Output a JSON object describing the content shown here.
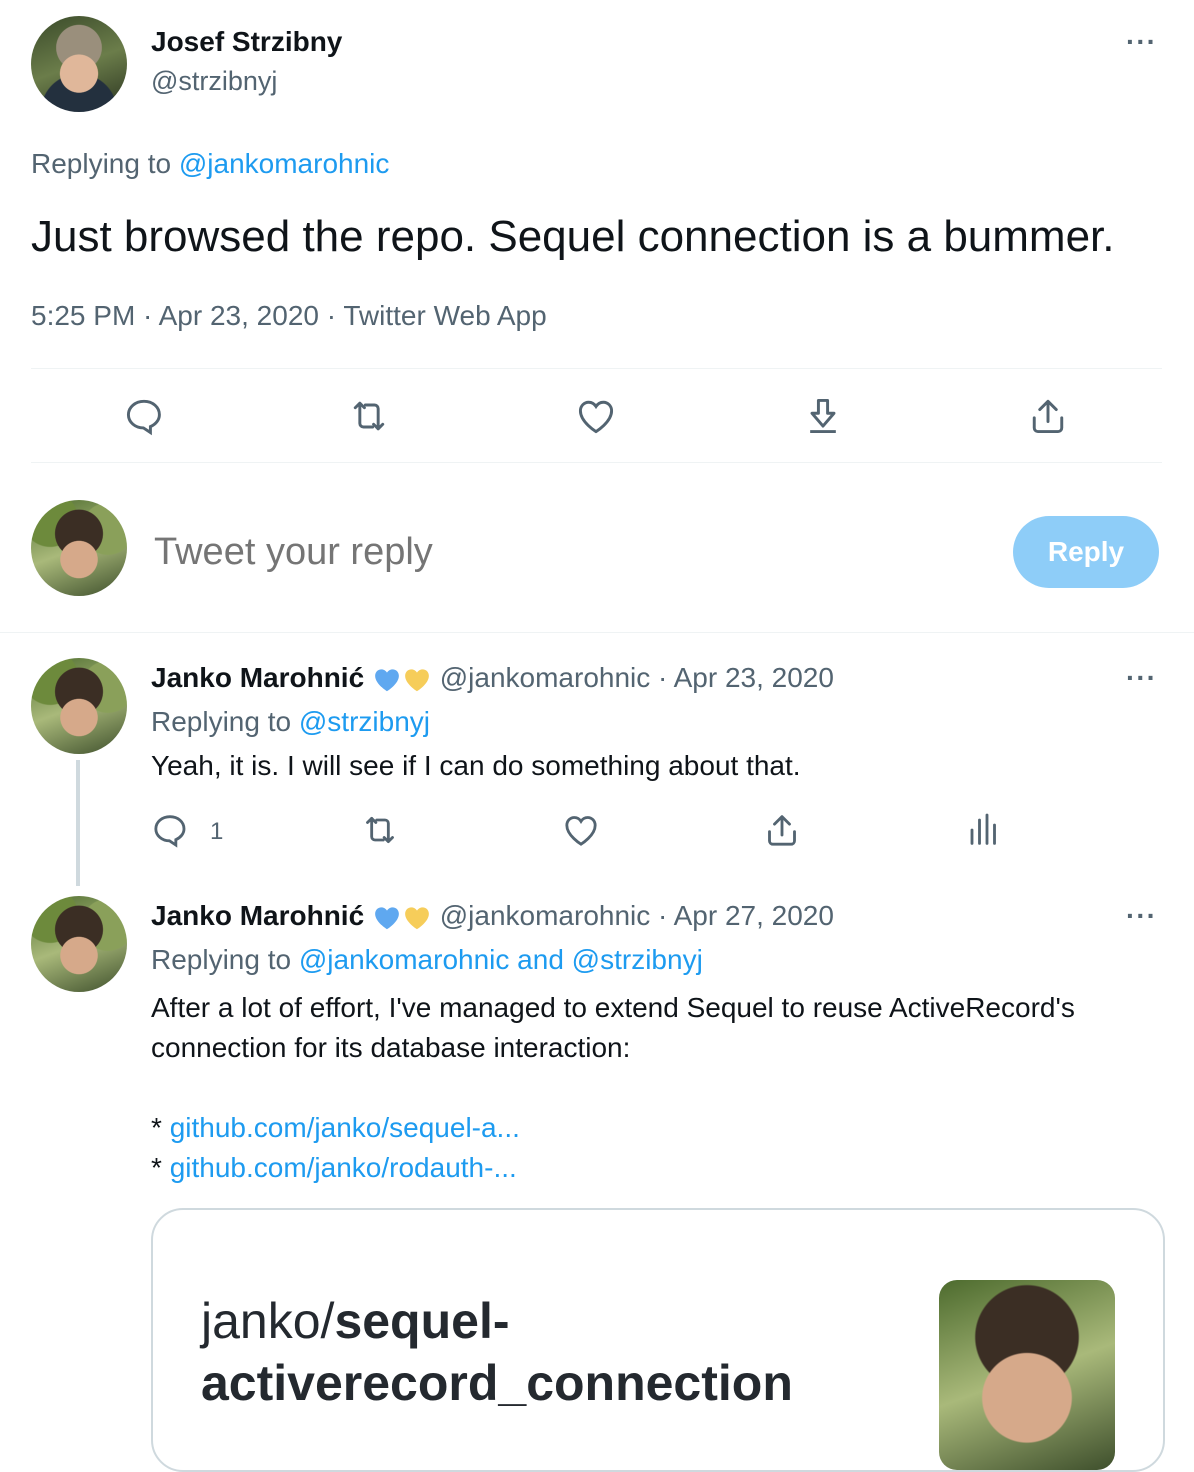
{
  "main_tweet": {
    "author_name": "Josef Strzibny",
    "author_handle": "@strzibnyj",
    "replying_prefix": "Replying to",
    "replying_to": "@jankomarohnic",
    "text": "Just browsed the repo. Sequel connection is a bummer.",
    "meta": "5:25 PM · Apr 23, 2020 · Twitter Web App",
    "more": "···"
  },
  "compose": {
    "placeholder": "Tweet your reply",
    "reply_label": "Reply"
  },
  "replies": [
    {
      "author_name": "Janko Marohnić",
      "handle_date": "@jankomarohnic · Apr 23, 2020",
      "replying_prefix": "Replying to",
      "replying_to": "@strzibnyj",
      "text": "Yeah, it is. I will see if I can do something about that.",
      "reply_count": "1",
      "more": "···"
    },
    {
      "author_name": "Janko Marohnić",
      "handle_date": "@jankomarohnic · Apr 27, 2020",
      "replying_prefix": "Replying to",
      "replying_to": "@jankomarohnic and @strzibnyj",
      "text_line1": "After a lot of effort, I've managed to extend Sequel to reuse ActiveRecord's",
      "text_line2": "connection for its database interaction:",
      "bullet": "*",
      "link1": "github.com/janko/sequel-a...",
      "link2": "github.com/janko/rodauth-...",
      "more": "···",
      "card": {
        "title_prefix": "janko/",
        "title_bold1": "sequel-",
        "title_bold2": "activerecord_connection"
      }
    }
  ],
  "colors": {
    "link": "#1d9bf0",
    "heart_blue": "#5fa8f0",
    "heart_yellow": "#f6cd5a",
    "reply_button": "#8ecdf8"
  }
}
